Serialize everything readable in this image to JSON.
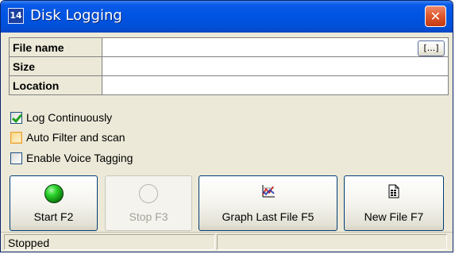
{
  "window": {
    "title": "Disk Logging",
    "close_glyph": "✕",
    "app_icon_glyph": "14"
  },
  "info": {
    "rows": [
      {
        "label": "File name",
        "value": ""
      },
      {
        "label": "Size",
        "value": ""
      },
      {
        "label": "Location",
        "value": ""
      }
    ],
    "browse_label": "[...]"
  },
  "options": [
    {
      "label": "Log Continuously",
      "checked": true
    },
    {
      "label": "Auto Filter and scan",
      "checked": false
    },
    {
      "label": "Enable Voice Tagging",
      "checked": false
    }
  ],
  "buttons": {
    "start": {
      "label": "Start F2",
      "icon": "green-led-icon",
      "enabled": true
    },
    "stop": {
      "label": "Stop F3",
      "icon": "gray-led-icon",
      "enabled": false
    },
    "graph": {
      "label": "Graph Last File F5",
      "icon": "graph-icon",
      "enabled": true
    },
    "new_file": {
      "label": "New File F7",
      "icon": "new-file-icon",
      "enabled": true
    }
  },
  "status": {
    "text": "Stopped",
    "secondary": ""
  },
  "colors": {
    "title_bar": "#0054e3",
    "close_button": "#e05a30",
    "face": "#ece9d8",
    "check_mark": "#21a121",
    "led_on": "#2fd72f"
  }
}
